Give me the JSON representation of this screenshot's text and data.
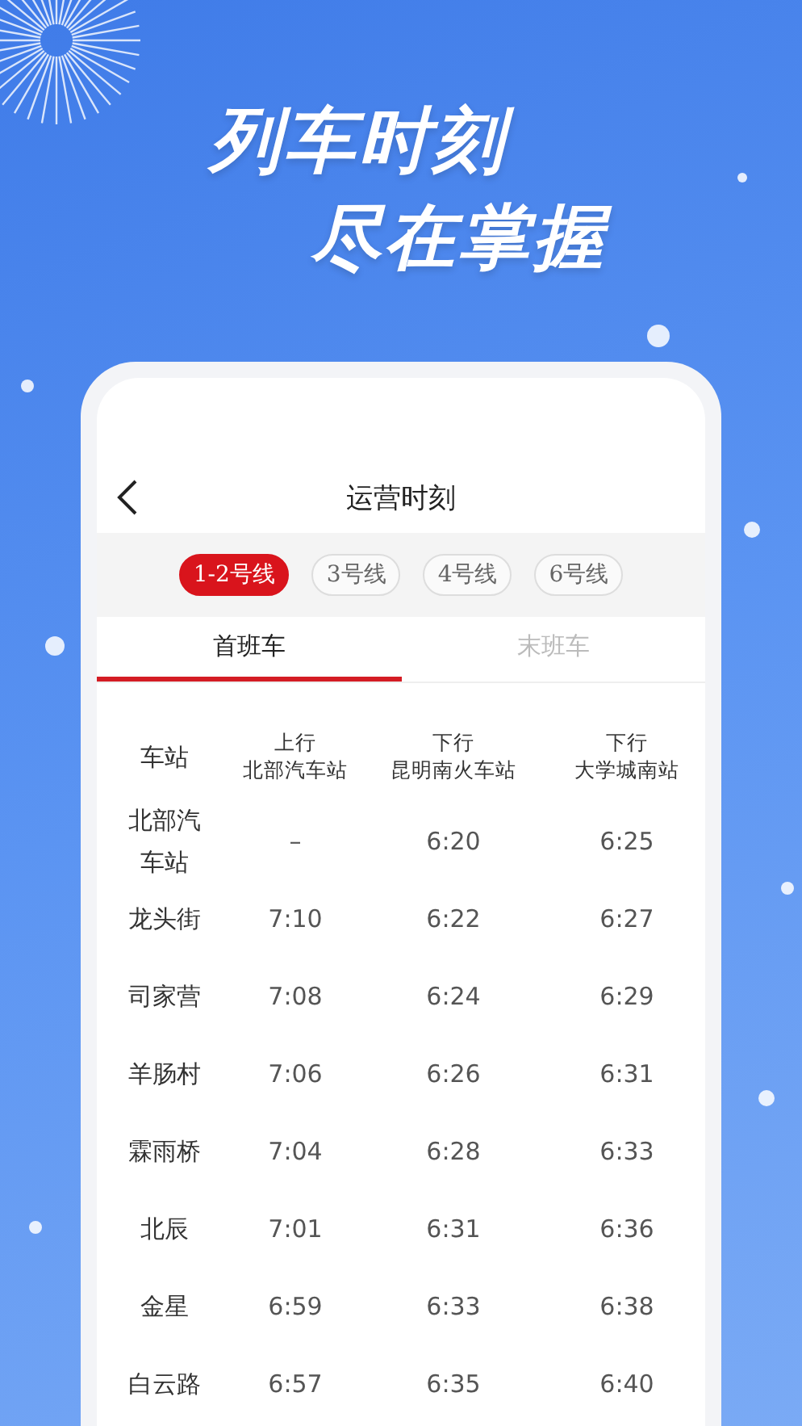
{
  "headline": [
    "列车时刻",
    "尽在掌握"
  ],
  "nav": {
    "title": "运营时刻"
  },
  "lines": [
    {
      "label": "1-2号线",
      "selected": true
    },
    {
      "label": "3号线",
      "selected": false
    },
    {
      "label": "4号线",
      "selected": false
    },
    {
      "label": "6号线",
      "selected": false
    }
  ],
  "tabs": [
    {
      "label": "首班车",
      "selected": true
    },
    {
      "label": "末班车",
      "selected": false
    }
  ],
  "table": {
    "columns": [
      {
        "title": "车站"
      },
      {
        "direction": "上行",
        "terminal": "北部汽车站"
      },
      {
        "direction": "下行",
        "terminal": "昆明南火车站"
      },
      {
        "direction": "下行",
        "terminal": "大学城南站"
      }
    ],
    "rows": [
      [
        "北部汽车站",
        "–",
        "6:20",
        "6:25"
      ],
      [
        "龙头街",
        "7:10",
        "6:22",
        "6:27"
      ],
      [
        "司家营",
        "7:08",
        "6:24",
        "6:29"
      ],
      [
        "羊肠村",
        "7:06",
        "6:26",
        "6:31"
      ],
      [
        "霖雨桥",
        "7:04",
        "6:28",
        "6:33"
      ],
      [
        "北辰",
        "7:01",
        "6:31",
        "6:36"
      ],
      [
        "金星",
        "6:59",
        "6:33",
        "6:38"
      ],
      [
        "白云路",
        "6:57",
        "6:35",
        "6:40"
      ]
    ]
  }
}
